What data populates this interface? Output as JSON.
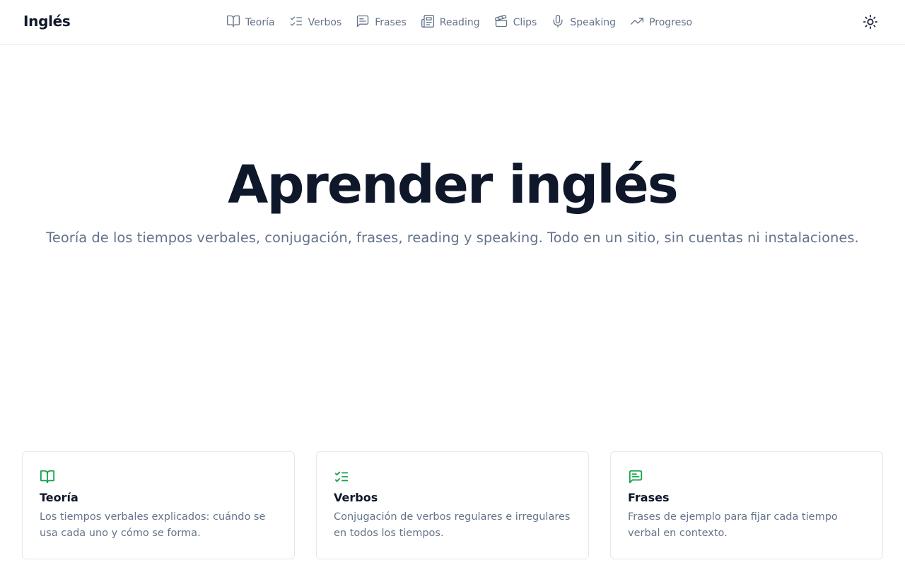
{
  "brand": "Inglés",
  "nav": {
    "items": [
      {
        "label": "Teoría",
        "icon": "book-open-icon"
      },
      {
        "label": "Verbos",
        "icon": "list-checks-icon"
      },
      {
        "label": "Frases",
        "icon": "message-square-text-icon"
      },
      {
        "label": "Reading",
        "icon": "newspaper-icon"
      },
      {
        "label": "Clips",
        "icon": "clapperboard-icon"
      },
      {
        "label": "Speaking",
        "icon": "microphone-icon"
      },
      {
        "label": "Progreso",
        "icon": "trending-up-icon"
      }
    ]
  },
  "theme_toggle": {
    "icon": "sun-icon"
  },
  "hero": {
    "title": "Aprender inglés",
    "subtitle": "Teoría de los tiempos verbales, conjugación, frases, reading y speaking. Todo en un sitio, sin cuentas ni instalaciones."
  },
  "cards": [
    {
      "title": "Teoría",
      "description": "Los tiempos verbales explicados: cuándo se usa cada uno y cómo se forma.",
      "icon": "book-open-icon"
    },
    {
      "title": "Verbos",
      "description": "Conjugación de verbos regulares e irregulares en todos los tiempos.",
      "icon": "list-checks-icon"
    },
    {
      "title": "Frases",
      "description": "Frases de ejemplo para fijar cada tiempo verbal en contexto.",
      "icon": "message-square-text-icon"
    }
  ],
  "colors": {
    "accent": "#16a34a",
    "text_primary": "#0f172a",
    "text_muted": "#64748b",
    "border": "#e2e8f0"
  }
}
